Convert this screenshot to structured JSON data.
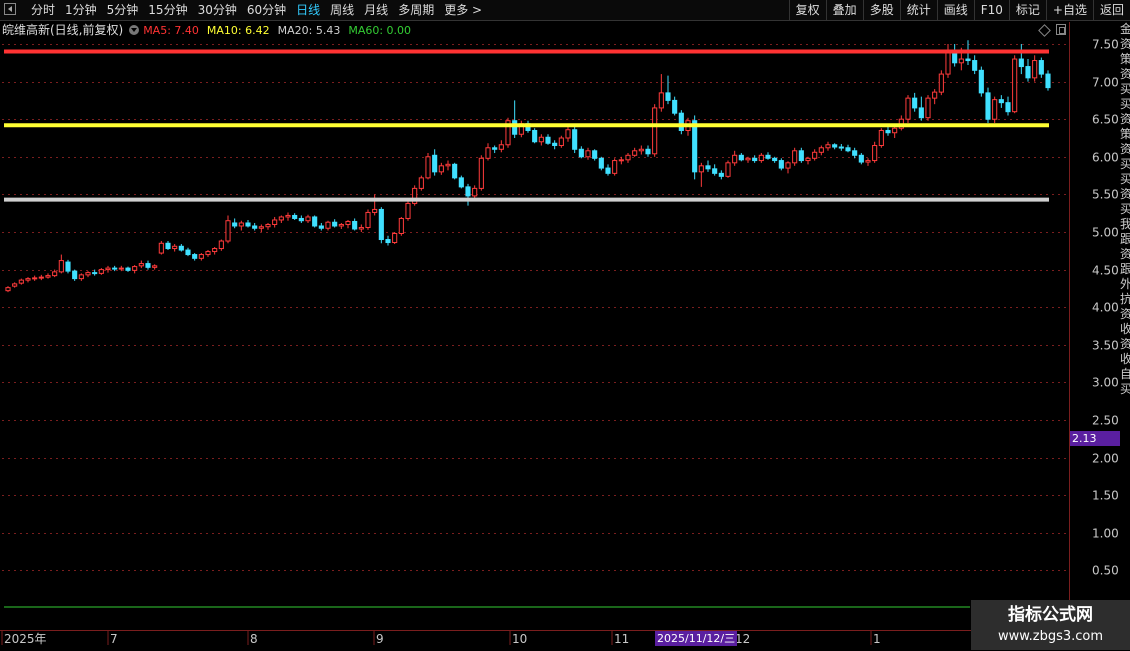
{
  "toolbar": {
    "periods": [
      "分时",
      "1分钟",
      "5分钟",
      "15分钟",
      "30分钟",
      "60分钟",
      "日线",
      "周线",
      "月线",
      "多周期",
      "更多 >"
    ],
    "active_period": "日线",
    "tools": [
      "复权",
      "叠加",
      "多股",
      "统计",
      "画线",
      "F10",
      "标记",
      "+自选",
      "返回"
    ]
  },
  "info": {
    "stock_label": "皖维高新(日线,前复权)",
    "ma5": "MA5: 7.40",
    "ma10": "MA10: 6.42",
    "ma20": "MA20: 5.43",
    "ma60": "MA60: 0.00"
  },
  "colors": {
    "up": "#ff3b3b",
    "down": "#40e0ff",
    "ma5": "#ff3333",
    "ma10": "#ffff33",
    "ma20": "#d0d0d0",
    "ma60": "#33cc33",
    "grid": "#7a1e1e",
    "axis_text": "#c8c8c8"
  },
  "cursor": {
    "price": "2.13",
    "date": "2025/11/12/三"
  },
  "side_text": "金资策资买买资策资买买资买我跟资跟外抗资收资收自买",
  "watermark": {
    "line1": "指标公式网",
    "line2": "www.zbgs3.com"
  },
  "chart_data": {
    "type": "candlestick",
    "title": "",
    "ylim": [
      0,
      7.75
    ],
    "yticks": [
      "7.50",
      "7.00",
      "6.50",
      "6.00",
      "5.50",
      "5.00",
      "4.50",
      "4.00",
      "3.50",
      "3.00",
      "2.50",
      "2.00",
      "1.50",
      "1.00",
      "0.50"
    ],
    "xlabels": [
      "2025年",
      "7",
      "8",
      "9",
      "10",
      "11",
      "12",
      "1"
    ],
    "ma_lines": [
      {
        "name": "MA5",
        "value": 7.4
      },
      {
        "name": "MA10",
        "value": 6.42
      },
      {
        "name": "MA20",
        "value": 5.43
      },
      {
        "name": "MA60",
        "value": 0.0
      }
    ],
    "candles": [
      {
        "o": 4.22,
        "h": 4.28,
        "l": 4.2,
        "c": 4.26
      },
      {
        "o": 4.28,
        "h": 4.33,
        "l": 4.26,
        "c": 4.31
      },
      {
        "o": 4.32,
        "h": 4.38,
        "l": 4.3,
        "c": 4.36
      },
      {
        "o": 4.36,
        "h": 4.4,
        "l": 4.33,
        "c": 4.38
      },
      {
        "o": 4.38,
        "h": 4.42,
        "l": 4.35,
        "c": 4.39
      },
      {
        "o": 4.39,
        "h": 4.43,
        "l": 4.36,
        "c": 4.4
      },
      {
        "o": 4.4,
        "h": 4.45,
        "l": 4.38,
        "c": 4.42
      },
      {
        "o": 4.42,
        "h": 4.5,
        "l": 4.4,
        "c": 4.47
      },
      {
        "o": 4.47,
        "h": 4.7,
        "l": 4.45,
        "c": 4.62
      },
      {
        "o": 4.6,
        "h": 4.63,
        "l": 4.45,
        "c": 4.48
      },
      {
        "o": 4.48,
        "h": 4.5,
        "l": 4.35,
        "c": 4.38
      },
      {
        "o": 4.38,
        "h": 4.45,
        "l": 4.35,
        "c": 4.43
      },
      {
        "o": 4.43,
        "h": 4.48,
        "l": 4.4,
        "c": 4.46
      },
      {
        "o": 4.46,
        "h": 4.5,
        "l": 4.42,
        "c": 4.45
      },
      {
        "o": 4.45,
        "h": 4.52,
        "l": 4.43,
        "c": 4.5
      },
      {
        "o": 4.5,
        "h": 4.55,
        "l": 4.46,
        "c": 4.52
      },
      {
        "o": 4.52,
        "h": 4.55,
        "l": 4.48,
        "c": 4.51
      },
      {
        "o": 4.51,
        "h": 4.55,
        "l": 4.48,
        "c": 4.52
      },
      {
        "o": 4.52,
        "h": 4.54,
        "l": 4.47,
        "c": 4.49
      },
      {
        "o": 4.49,
        "h": 4.56,
        "l": 4.45,
        "c": 4.54
      },
      {
        "o": 4.55,
        "h": 4.62,
        "l": 4.52,
        "c": 4.58
      },
      {
        "o": 4.58,
        "h": 4.62,
        "l": 4.5,
        "c": 4.53
      },
      {
        "o": 4.53,
        "h": 4.57,
        "l": 4.5,
        "c": 4.55
      },
      {
        "o": 4.72,
        "h": 4.88,
        "l": 4.7,
        "c": 4.85
      },
      {
        "o": 4.85,
        "h": 4.88,
        "l": 4.76,
        "c": 4.78
      },
      {
        "o": 4.78,
        "h": 4.84,
        "l": 4.74,
        "c": 4.81
      },
      {
        "o": 4.81,
        "h": 4.84,
        "l": 4.74,
        "c": 4.76
      },
      {
        "o": 4.76,
        "h": 4.79,
        "l": 4.68,
        "c": 4.7
      },
      {
        "o": 4.7,
        "h": 4.72,
        "l": 4.62,
        "c": 4.65
      },
      {
        "o": 4.65,
        "h": 4.72,
        "l": 4.62,
        "c": 4.7
      },
      {
        "o": 4.7,
        "h": 4.76,
        "l": 4.67,
        "c": 4.74
      },
      {
        "o": 4.74,
        "h": 4.8,
        "l": 4.7,
        "c": 4.78
      },
      {
        "o": 4.78,
        "h": 4.9,
        "l": 4.75,
        "c": 4.88
      },
      {
        "o": 4.88,
        "h": 5.22,
        "l": 4.85,
        "c": 5.15
      },
      {
        "o": 5.12,
        "h": 5.18,
        "l": 5.05,
        "c": 5.08
      },
      {
        "o": 5.08,
        "h": 5.15,
        "l": 5.02,
        "c": 5.12
      },
      {
        "o": 5.12,
        "h": 5.16,
        "l": 5.06,
        "c": 5.08
      },
      {
        "o": 5.08,
        "h": 5.12,
        "l": 5.02,
        "c": 5.05
      },
      {
        "o": 5.05,
        "h": 5.1,
        "l": 5.0,
        "c": 5.07
      },
      {
        "o": 5.07,
        "h": 5.12,
        "l": 5.03,
        "c": 5.1
      },
      {
        "o": 5.1,
        "h": 5.2,
        "l": 5.06,
        "c": 5.16
      },
      {
        "o": 5.16,
        "h": 5.22,
        "l": 5.12,
        "c": 5.2
      },
      {
        "o": 5.2,
        "h": 5.26,
        "l": 5.15,
        "c": 5.22
      },
      {
        "o": 5.22,
        "h": 5.25,
        "l": 5.16,
        "c": 5.18
      },
      {
        "o": 5.18,
        "h": 5.22,
        "l": 5.12,
        "c": 5.15
      },
      {
        "o": 5.15,
        "h": 5.23,
        "l": 5.12,
        "c": 5.2
      },
      {
        "o": 5.2,
        "h": 5.22,
        "l": 5.06,
        "c": 5.08
      },
      {
        "o": 5.08,
        "h": 5.12,
        "l": 5.02,
        "c": 5.05
      },
      {
        "o": 5.05,
        "h": 5.15,
        "l": 5.02,
        "c": 5.13
      },
      {
        "o": 5.13,
        "h": 5.17,
        "l": 5.06,
        "c": 5.08
      },
      {
        "o": 5.08,
        "h": 5.12,
        "l": 5.04,
        "c": 5.1
      },
      {
        "o": 5.1,
        "h": 5.16,
        "l": 5.05,
        "c": 5.14
      },
      {
        "o": 5.14,
        "h": 5.18,
        "l": 5.02,
        "c": 5.04
      },
      {
        "o": 5.04,
        "h": 5.1,
        "l": 5.0,
        "c": 5.06
      },
      {
        "o": 5.06,
        "h": 5.3,
        "l": 5.03,
        "c": 5.26
      },
      {
        "o": 5.26,
        "h": 5.5,
        "l": 5.22,
        "c": 5.3
      },
      {
        "o": 5.3,
        "h": 5.33,
        "l": 4.85,
        "c": 4.9
      },
      {
        "o": 4.9,
        "h": 4.95,
        "l": 4.82,
        "c": 4.86
      },
      {
        "o": 4.86,
        "h": 5.0,
        "l": 4.84,
        "c": 4.98
      },
      {
        "o": 4.98,
        "h": 5.2,
        "l": 4.95,
        "c": 5.18
      },
      {
        "o": 5.18,
        "h": 5.42,
        "l": 5.15,
        "c": 5.38
      },
      {
        "o": 5.38,
        "h": 5.62,
        "l": 5.35,
        "c": 5.58
      },
      {
        "o": 5.58,
        "h": 5.75,
        "l": 5.55,
        "c": 5.72
      },
      {
        "o": 5.72,
        "h": 6.05,
        "l": 5.7,
        "c": 6.0
      },
      {
        "o": 6.02,
        "h": 6.1,
        "l": 5.75,
        "c": 5.8
      },
      {
        "o": 5.8,
        "h": 5.92,
        "l": 5.76,
        "c": 5.88
      },
      {
        "o": 5.88,
        "h": 5.95,
        "l": 5.82,
        "c": 5.9
      },
      {
        "o": 5.9,
        "h": 5.92,
        "l": 5.7,
        "c": 5.72
      },
      {
        "o": 5.72,
        "h": 5.75,
        "l": 5.58,
        "c": 5.6
      },
      {
        "o": 5.6,
        "h": 5.64,
        "l": 5.35,
        "c": 5.48
      },
      {
        "o": 5.48,
        "h": 5.62,
        "l": 5.44,
        "c": 5.58
      },
      {
        "o": 5.58,
        "h": 6.02,
        "l": 5.55,
        "c": 5.98
      },
      {
        "o": 5.98,
        "h": 6.18,
        "l": 5.95,
        "c": 6.12
      },
      {
        "o": 6.12,
        "h": 6.15,
        "l": 6.05,
        "c": 6.1
      },
      {
        "o": 6.1,
        "h": 6.22,
        "l": 6.06,
        "c": 6.16
      },
      {
        "o": 6.16,
        "h": 6.52,
        "l": 6.12,
        "c": 6.48
      },
      {
        "o": 6.48,
        "h": 6.75,
        "l": 6.25,
        "c": 6.3
      },
      {
        "o": 6.3,
        "h": 6.48,
        "l": 6.26,
        "c": 6.44
      },
      {
        "o": 6.44,
        "h": 6.48,
        "l": 6.32,
        "c": 6.35
      },
      {
        "o": 6.35,
        "h": 6.38,
        "l": 6.18,
        "c": 6.2
      },
      {
        "o": 6.2,
        "h": 6.3,
        "l": 6.15,
        "c": 6.26
      },
      {
        "o": 6.26,
        "h": 6.3,
        "l": 6.16,
        "c": 6.18
      },
      {
        "o": 6.18,
        "h": 6.22,
        "l": 6.1,
        "c": 6.15
      },
      {
        "o": 6.15,
        "h": 6.28,
        "l": 6.12,
        "c": 6.25
      },
      {
        "o": 6.25,
        "h": 6.4,
        "l": 6.2,
        "c": 6.36
      },
      {
        "o": 6.36,
        "h": 6.4,
        "l": 6.05,
        "c": 6.1
      },
      {
        "o": 6.1,
        "h": 6.14,
        "l": 5.98,
        "c": 6.0
      },
      {
        "o": 6.0,
        "h": 6.12,
        "l": 5.96,
        "c": 6.08
      },
      {
        "o": 6.08,
        "h": 6.1,
        "l": 5.95,
        "c": 5.98
      },
      {
        "o": 5.98,
        "h": 6.0,
        "l": 5.82,
        "c": 5.85
      },
      {
        "o": 5.85,
        "h": 5.9,
        "l": 5.75,
        "c": 5.78
      },
      {
        "o": 5.78,
        "h": 5.98,
        "l": 5.75,
        "c": 5.95
      },
      {
        "o": 5.95,
        "h": 6.0,
        "l": 5.9,
        "c": 5.96
      },
      {
        "o": 5.96,
        "h": 6.05,
        "l": 5.92,
        "c": 6.02
      },
      {
        "o": 6.02,
        "h": 6.12,
        "l": 6.0,
        "c": 6.08
      },
      {
        "o": 6.08,
        "h": 6.15,
        "l": 6.03,
        "c": 6.1
      },
      {
        "o": 6.1,
        "h": 6.15,
        "l": 6.0,
        "c": 6.04
      },
      {
        "o": 6.04,
        "h": 6.7,
        "l": 6.0,
        "c": 6.65
      },
      {
        "o": 6.65,
        "h": 7.1,
        "l": 6.6,
        "c": 6.85
      },
      {
        "o": 6.85,
        "h": 7.08,
        "l": 6.7,
        "c": 6.75
      },
      {
        "o": 6.75,
        "h": 6.8,
        "l": 6.55,
        "c": 6.58
      },
      {
        "o": 6.58,
        "h": 6.62,
        "l": 6.3,
        "c": 6.35
      },
      {
        "o": 6.35,
        "h": 6.52,
        "l": 6.28,
        "c": 6.48
      },
      {
        "o": 6.48,
        "h": 6.55,
        "l": 5.7,
        "c": 5.8
      },
      {
        "o": 5.8,
        "h": 5.92,
        "l": 5.6,
        "c": 5.88
      },
      {
        "o": 5.88,
        "h": 5.95,
        "l": 5.8,
        "c": 5.84
      },
      {
        "o": 5.84,
        "h": 5.9,
        "l": 5.75,
        "c": 5.78
      },
      {
        "o": 5.78,
        "h": 5.82,
        "l": 5.7,
        "c": 5.74
      },
      {
        "o": 5.74,
        "h": 5.95,
        "l": 5.72,
        "c": 5.92
      },
      {
        "o": 5.92,
        "h": 6.08,
        "l": 5.88,
        "c": 6.02
      },
      {
        "o": 6.02,
        "h": 6.05,
        "l": 5.94,
        "c": 5.96
      },
      {
        "o": 5.96,
        "h": 6.0,
        "l": 5.92,
        "c": 5.98
      },
      {
        "o": 5.98,
        "h": 6.02,
        "l": 5.92,
        "c": 5.95
      },
      {
        "o": 5.95,
        "h": 6.05,
        "l": 5.92,
        "c": 6.02
      },
      {
        "o": 6.02,
        "h": 6.06,
        "l": 5.96,
        "c": 5.98
      },
      {
        "o": 5.98,
        "h": 6.0,
        "l": 5.92,
        "c": 5.95
      },
      {
        "o": 5.95,
        "h": 5.98,
        "l": 5.82,
        "c": 5.85
      },
      {
        "o": 5.85,
        "h": 5.94,
        "l": 5.78,
        "c": 5.92
      },
      {
        "o": 5.92,
        "h": 6.12,
        "l": 5.88,
        "c": 6.08
      },
      {
        "o": 6.08,
        "h": 6.12,
        "l": 5.92,
        "c": 5.95
      },
      {
        "o": 5.95,
        "h": 6.0,
        "l": 5.9,
        "c": 5.98
      },
      {
        "o": 5.98,
        "h": 6.1,
        "l": 5.95,
        "c": 6.06
      },
      {
        "o": 6.06,
        "h": 6.15,
        "l": 6.02,
        "c": 6.12
      },
      {
        "o": 6.12,
        "h": 6.2,
        "l": 6.08,
        "c": 6.16
      },
      {
        "o": 6.16,
        "h": 6.18,
        "l": 6.1,
        "c": 6.13
      },
      {
        "o": 6.13,
        "h": 6.17,
        "l": 6.08,
        "c": 6.12
      },
      {
        "o": 6.12,
        "h": 6.16,
        "l": 6.06,
        "c": 6.08
      },
      {
        "o": 6.08,
        "h": 6.12,
        "l": 5.98,
        "c": 6.02
      },
      {
        "o": 6.02,
        "h": 6.05,
        "l": 5.9,
        "c": 5.93
      },
      {
        "o": 5.93,
        "h": 5.98,
        "l": 5.88,
        "c": 5.95
      },
      {
        "o": 5.95,
        "h": 6.2,
        "l": 5.92,
        "c": 6.15
      },
      {
        "o": 6.15,
        "h": 6.38,
        "l": 6.12,
        "c": 6.35
      },
      {
        "o": 6.35,
        "h": 6.4,
        "l": 6.28,
        "c": 6.32
      },
      {
        "o": 6.32,
        "h": 6.42,
        "l": 6.25,
        "c": 6.38
      },
      {
        "o": 6.38,
        "h": 6.55,
        "l": 6.35,
        "c": 6.5
      },
      {
        "o": 6.5,
        "h": 6.82,
        "l": 6.45,
        "c": 6.78
      },
      {
        "o": 6.78,
        "h": 6.85,
        "l": 6.6,
        "c": 6.65
      },
      {
        "o": 6.65,
        "h": 6.8,
        "l": 6.48,
        "c": 6.52
      },
      {
        "o": 6.52,
        "h": 6.82,
        "l": 6.48,
        "c": 6.78
      },
      {
        "o": 6.78,
        "h": 6.9,
        "l": 6.7,
        "c": 6.86
      },
      {
        "o": 6.86,
        "h": 7.15,
        "l": 6.82,
        "c": 7.1
      },
      {
        "o": 7.1,
        "h": 7.5,
        "l": 7.05,
        "c": 7.42
      },
      {
        "o": 7.42,
        "h": 7.5,
        "l": 7.2,
        "c": 7.25
      },
      {
        "o": 7.25,
        "h": 7.45,
        "l": 7.15,
        "c": 7.3
      },
      {
        "o": 7.3,
        "h": 7.55,
        "l": 7.22,
        "c": 7.28
      },
      {
        "o": 7.28,
        "h": 7.35,
        "l": 7.1,
        "c": 7.15
      },
      {
        "o": 7.15,
        "h": 7.2,
        "l": 6.8,
        "c": 6.85
      },
      {
        "o": 6.85,
        "h": 6.92,
        "l": 6.45,
        "c": 6.5
      },
      {
        "o": 6.5,
        "h": 6.8,
        "l": 6.45,
        "c": 6.76
      },
      {
        "o": 6.76,
        "h": 6.82,
        "l": 6.65,
        "c": 6.72
      },
      {
        "o": 6.72,
        "h": 6.8,
        "l": 6.55,
        "c": 6.6
      },
      {
        "o": 6.6,
        "h": 7.35,
        "l": 6.58,
        "c": 7.3
      },
      {
        "o": 7.3,
        "h": 7.5,
        "l": 7.1,
        "c": 7.2
      },
      {
        "o": 7.2,
        "h": 7.3,
        "l": 7.0,
        "c": 7.05
      },
      {
        "o": 7.05,
        "h": 7.35,
        "l": 7.0,
        "c": 7.28
      },
      {
        "o": 7.28,
        "h": 7.32,
        "l": 7.05,
        "c": 7.1
      },
      {
        "o": 7.1,
        "h": 7.15,
        "l": 6.88,
        "c": 6.92
      }
    ]
  }
}
